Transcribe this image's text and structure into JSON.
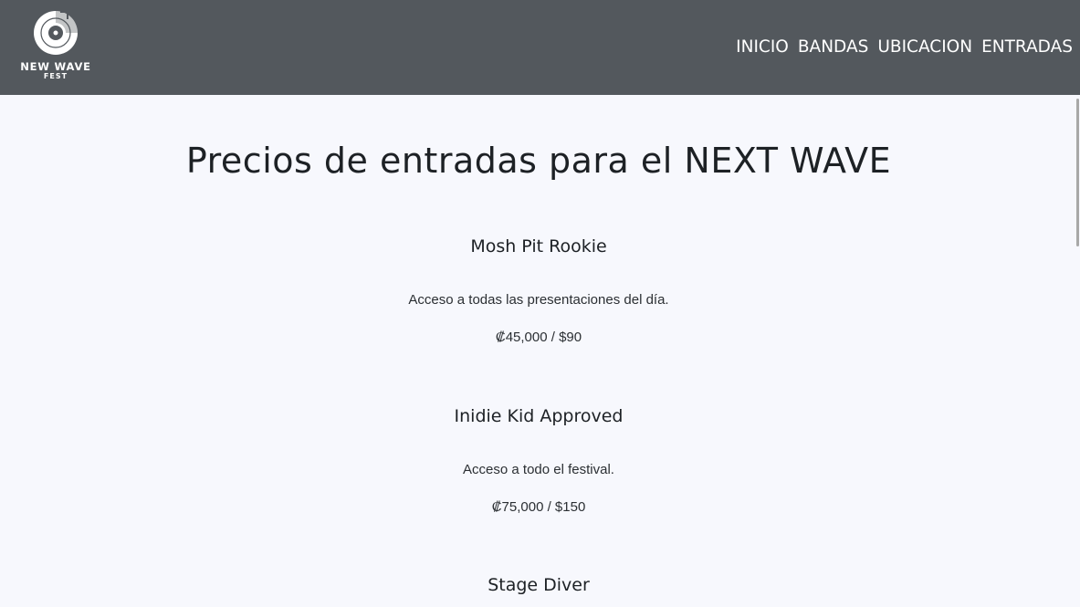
{
  "brand": {
    "name": "NEW WAVE",
    "sub": "FEST",
    "icon": "vinyl-record-icon",
    "color": "#53585d"
  },
  "nav": {
    "items": [
      {
        "label": "INICIO"
      },
      {
        "label": "BANDAS"
      },
      {
        "label": "UBICACION"
      },
      {
        "label": "ENTRADAS"
      }
    ]
  },
  "main": {
    "title": "Precios de entradas para el NEXT WAVE",
    "tickets": [
      {
        "name": "Mosh Pit Rookie",
        "description": "Acceso a todas las presentaciones del día.",
        "price": "₡45,000 / $90"
      },
      {
        "name": "Inidie Kid Approved",
        "description": "Acceso a todo el festival.",
        "price": "₡75,000 / $150"
      },
      {
        "name": "Stage Diver",
        "description": "",
        "price": ""
      }
    ]
  },
  "colors": {
    "navbar_bg": "#53585d",
    "page_bg": "#f7f8fd",
    "text": "#1d2125"
  }
}
